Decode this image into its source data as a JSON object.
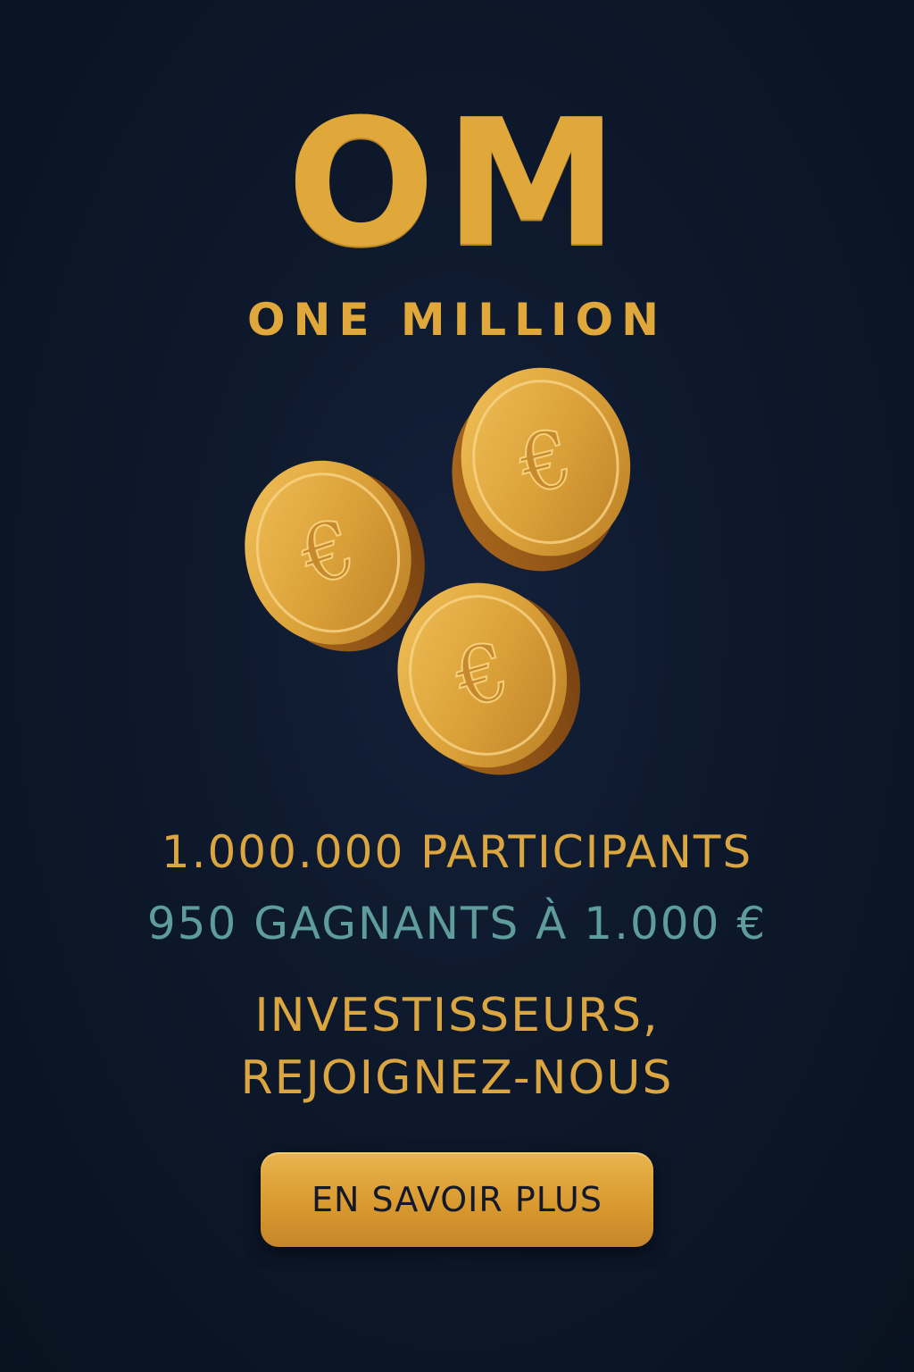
{
  "brand": {
    "logo": "OM",
    "name": "ONE MILLION"
  },
  "coins": {
    "symbol": "€"
  },
  "stats": {
    "participants": "1.000.000 PARTICIPANTS",
    "winners": "950 GAGNANTS À 1.000 €"
  },
  "call": {
    "line1": "INVESTISSEURS,",
    "line2": "REJOIGNEZ-NOUS"
  },
  "cta": {
    "label": "EN SAVOIR PLUS"
  },
  "colors": {
    "background": "#0b1524",
    "gold": "#e0a83b",
    "teal": "#5f9c9c",
    "button_text": "#13182a"
  }
}
